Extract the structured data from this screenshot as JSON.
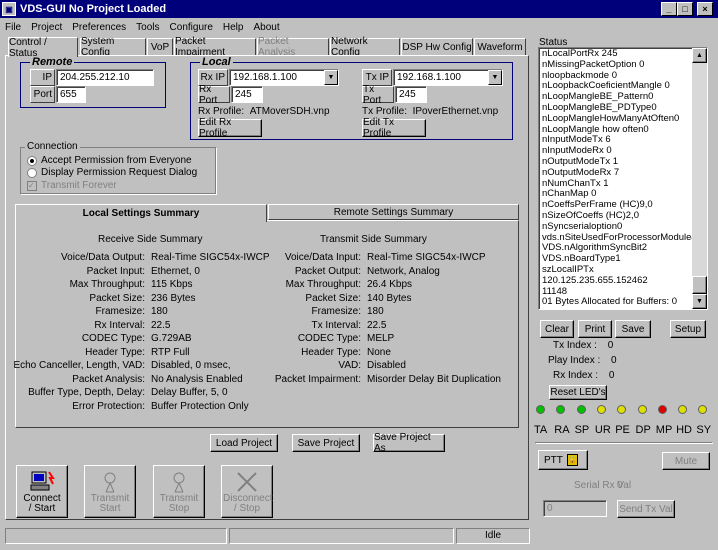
{
  "window": {
    "title": "VDS-GUI No Project Loaded",
    "min": "_",
    "max": "□",
    "close": "×"
  },
  "menu": [
    "File",
    "Project",
    "Preferences",
    "Tools",
    "Configure",
    "Help",
    "About"
  ],
  "tabs": [
    "Control / Status",
    "System Config",
    "VoP",
    "Packet Impairment",
    "Packet Analysis",
    "Network Config",
    "DSP Hw Config",
    "Waveform"
  ],
  "remote": {
    "title": "Remote",
    "ip_label": "IP",
    "ip": "204.255.212.10",
    "port_label": "Port",
    "port": "655"
  },
  "local": {
    "title": "Local",
    "rx_ip_label": "Rx IP",
    "rx_ip": "192.168.1.100",
    "rx_port_label": "Rx Port",
    "rx_port": "245",
    "tx_ip_label": "Tx IP",
    "tx_ip": "192.168.1.100",
    "tx_port_label": "Tx Port",
    "tx_port": "245",
    "rx_profile_label": "Rx Profile:",
    "rx_profile": "ATMoverSDH.vnp",
    "tx_profile_label": "Tx Profile:",
    "tx_profile": "IPoverEthernet.vnp",
    "edit_rx": "Edit Rx Profile",
    "edit_tx": "Edit Tx Profile"
  },
  "connection": {
    "title": "Connection",
    "opt1": "Accept Permission from Everyone",
    "opt2": "Display Permission Request Dialog",
    "transmit_forever": "Transmit Forever"
  },
  "summary": {
    "tab_local": "Local Settings Summary",
    "tab_remote": "Remote Settings Summary",
    "rx_title": "Receive Side Summary",
    "tx_title": "Transmit Side Summary",
    "rx": [
      [
        "Voice/Data Output:",
        "Real-Time SIGC54x-IWCP"
      ],
      [
        "Packet Input:",
        "Ethernet, 0"
      ],
      [
        "Max Throughput:",
        "115 Kbps"
      ],
      [
        "Packet Size:",
        "236 Bytes"
      ],
      [
        "Framesize:",
        "180"
      ],
      [
        "Rx Interval:",
        "22.5"
      ],
      [
        "CODEC Type:",
        "G.729AB"
      ],
      [
        "Header Type:",
        "RTP Full"
      ],
      [
        "Echo Canceller, Length, VAD:",
        "Disabled, 0 msec,"
      ],
      [
        "Packet Analysis:",
        "No Analysis Enabled"
      ],
      [
        "Buffer Type, Depth, Delay:",
        "Delay Buffer, 5, 0"
      ],
      [
        "Error Protection:",
        "Buffer Protection Only"
      ]
    ],
    "tx": [
      [
        "Voice/Data Input:",
        "Real-Time SIGC54x-IWCP"
      ],
      [
        "Packet Output:",
        "Network, Analog"
      ],
      [
        "Max Throughput:",
        "26.4 Kbps"
      ],
      [
        "Packet Size:",
        "140 Bytes"
      ],
      [
        "Framesize:",
        "180"
      ],
      [
        "Tx Interval:",
        "22.5"
      ],
      [
        "CODEC Type:",
        "MELP"
      ],
      [
        "Header Type:",
        "None"
      ],
      [
        "VAD:",
        "Disabled"
      ],
      [
        "Packet Impairment:",
        "Misorder Delay Bit Duplication"
      ]
    ]
  },
  "project": {
    "load": "Load Project",
    "save": "Save Project",
    "save_as": "Save Project As"
  },
  "actions": {
    "connect": "Connect / Start",
    "transmit_start": "Transmit Start",
    "transmit_stop": "Transmit Stop",
    "disconnect": "Disconnect / Stop"
  },
  "statusbar": {
    "state": "Idle"
  },
  "status": {
    "title": "Status",
    "lines": [
      "nLocalPortRx 245",
      "nMissingPacketOption 0",
      "nloopbackmode 0",
      "nLoopbackCoeficientMangle 0",
      "nLoopMangleBE_Pattern0",
      "nLoopMangleBE_PDType0",
      "nLoopMangleHowManyAtOften0",
      "nLoopMangle how often0",
      "nInputModeTx 6",
      "nInputModeRx 0",
      "nOutputModeTx 1",
      "nOutputModeRx 7",
      "nNumChanTx 1",
      "nChanMap 0",
      "nCoeffsPerFrame (HC)9,0",
      "nSizeOfCoeffs (HC)2,0",
      "nSyncserialoption0",
      "vds.nSiteUsedForProcessorModule4",
      "VDS.nAlgorithmSyncBit2",
      "VDS.nBoardType1",
      "szLocalIPTx",
      "120.125.235.655.152462",
      "11148",
      "01 Bytes Allocated for Buffers: 0"
    ],
    "clear": "Clear",
    "print": "Print",
    "save": "Save",
    "setup": "Setup",
    "tx_index_label": "Tx Index :",
    "tx_index": "0",
    "play_index_label": "Play Index :",
    "play_index": "0",
    "rx_index_label": "Rx Index :",
    "rx_index": "0",
    "reset_leds": "Reset LED's",
    "leds": [
      {
        "label": "TA",
        "color": "#00c000"
      },
      {
        "label": "RA",
        "color": "#00c000"
      },
      {
        "label": "SP",
        "color": "#00c000"
      },
      {
        "label": "UR",
        "color": "#e0e000"
      },
      {
        "label": "PE",
        "color": "#e0e000"
      },
      {
        "label": "DP",
        "color": "#e0e000"
      },
      {
        "label": "MP",
        "color": "#e00000"
      },
      {
        "label": "HD",
        "color": "#e0e000"
      },
      {
        "label": "SY",
        "color": "#e0e000"
      }
    ],
    "ptt": "PTT",
    "mute": "Mute",
    "serial_rx_label": "Serial Rx Val",
    "serial_rx": "0",
    "send_value": "0",
    "send_tx": "Send Tx Val"
  }
}
